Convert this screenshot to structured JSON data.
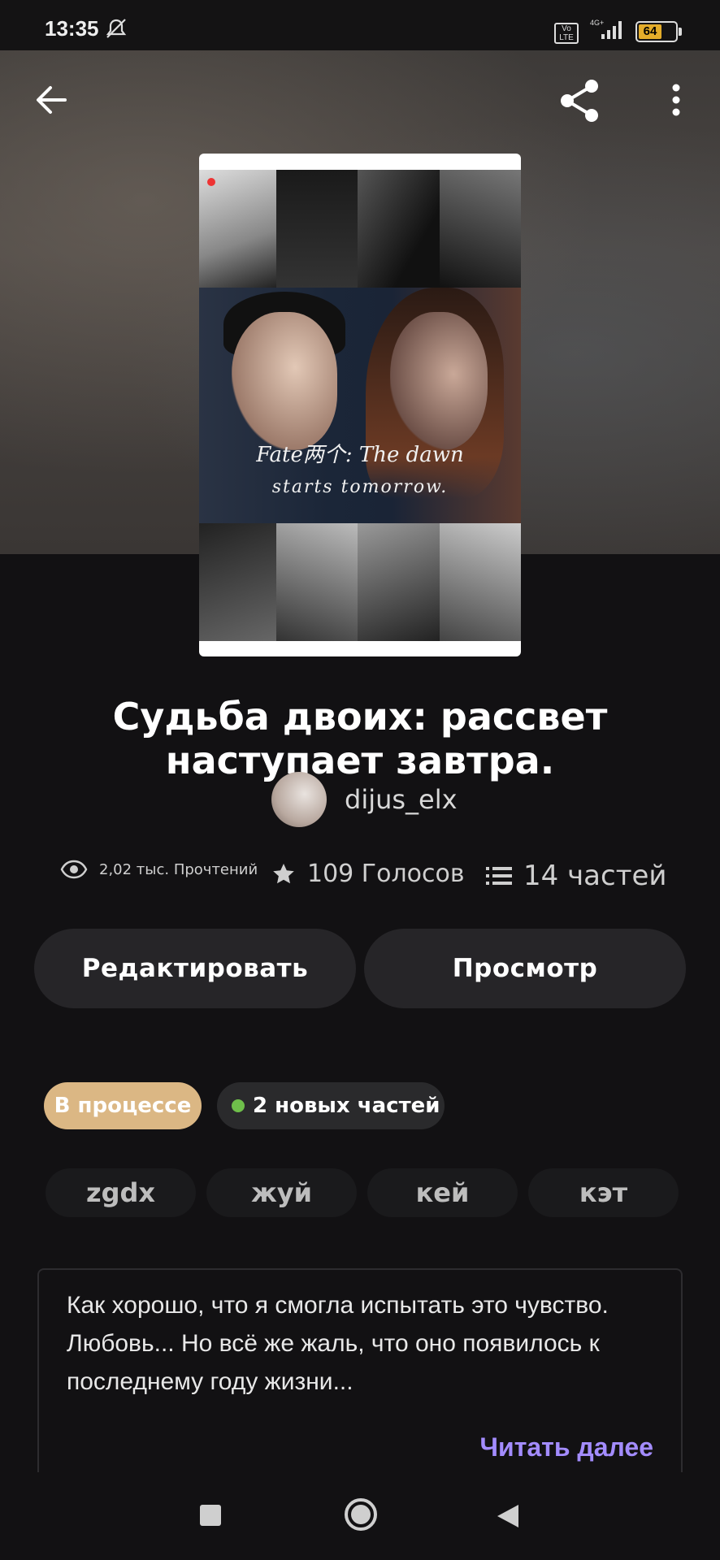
{
  "status_bar": {
    "time": "13:35",
    "volte_label": "Vo LTE",
    "network": "4G+",
    "battery": "64"
  },
  "cover": {
    "line1": "Fate两个: The dawn",
    "line2": "starts tomorrow."
  },
  "story": {
    "title": "Судьба двоих: рассвет наступает завтра.",
    "author": "dijus_elx"
  },
  "stats": {
    "reads": "2,02 тыс. Прочтений",
    "votes": "109 Голосов",
    "parts": "14 частей"
  },
  "buttons": {
    "edit": "Редактировать",
    "view": "Просмотр"
  },
  "tags": {
    "status": "В процессе",
    "new_parts": "2 новых частей"
  },
  "chips": [
    "zgdx",
    "жуй",
    "кей",
    "кэт"
  ],
  "description": {
    "text": "Как хорошо, что я смогла испытать это чувство. Любовь... Но всё же жаль, что оно появилось к последнему году жизни...",
    "read_more": "Читать далее"
  },
  "colors": {
    "background": "#121113",
    "status_tag": "#dbb784",
    "new_dot": "#6fbf4b",
    "read_more": "#a38cff",
    "button_bg": "#262528"
  }
}
